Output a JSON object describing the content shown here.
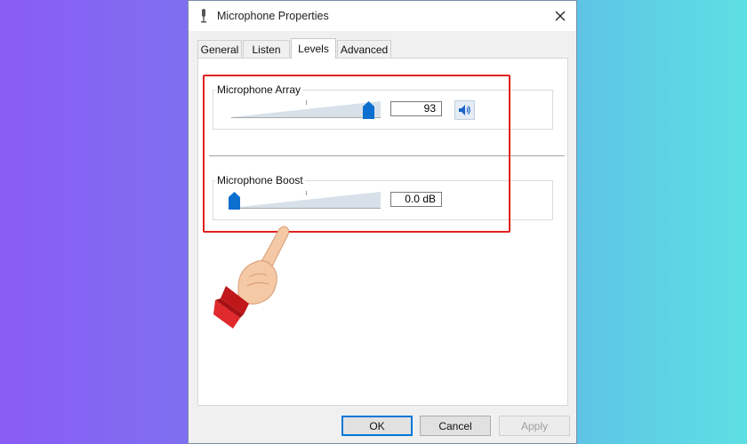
{
  "window": {
    "title": "Microphone Properties",
    "title_icon": "microphone-icon",
    "close_icon": "close-icon"
  },
  "tabs": [
    {
      "label": "General",
      "active": false
    },
    {
      "label": "Listen",
      "active": false
    },
    {
      "label": "Levels",
      "active": true
    },
    {
      "label": "Advanced",
      "active": false
    }
  ],
  "levels": {
    "microphone_array": {
      "label": "Microphone Array",
      "value": "93",
      "level_fraction": 0.93,
      "mute_icon": "speaker-icon"
    },
    "microphone_boost": {
      "label": "Microphone Boost",
      "value": "0.0 dB",
      "level_fraction": 0.0
    }
  },
  "buttons": {
    "ok": "OK",
    "cancel": "Cancel",
    "apply": "Apply"
  },
  "annotation": {
    "highlight_color": "#e0201f",
    "pointer_icon": "pointing-hand-icon"
  },
  "colors": {
    "accent": "#0078d7",
    "slider_thumb": "#0a6fcf"
  }
}
